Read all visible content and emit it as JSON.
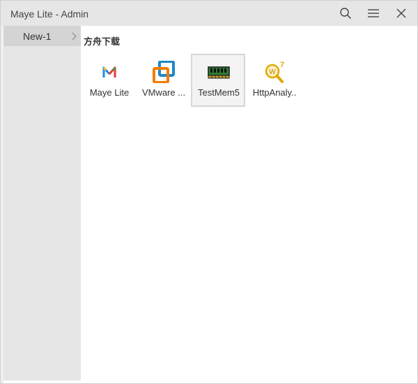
{
  "window": {
    "title": "Maye Lite - Admin"
  },
  "titlebar_buttons": {
    "search": "search-icon",
    "menu": "hamburger-menu-icon",
    "close": "close-icon"
  },
  "sidebar": {
    "items": [
      {
        "label": "New-1",
        "selected": true
      }
    ]
  },
  "main": {
    "section_title": "方舟下载",
    "apps": [
      {
        "label": "Maye Lite",
        "icon": "maye-lite-icon",
        "selected": false
      },
      {
        "label": "VMware ...",
        "icon": "vmware-icon",
        "selected": false
      },
      {
        "label": "TestMem5",
        "icon": "memory-module-icon",
        "selected": true
      },
      {
        "label": "HttpAnaly..",
        "icon": "http-analyzer-icon",
        "selected": false
      }
    ]
  },
  "colors": {
    "titlebar_bg": "#e6e6e6",
    "sidebar_bg": "#e6e6e6",
    "sidebar_selected_bg": "#d4d4d4",
    "content_bg": "#ffffff",
    "selected_tile_bg": "#f3f3f3",
    "selected_tile_border": "#d6d6d6"
  }
}
